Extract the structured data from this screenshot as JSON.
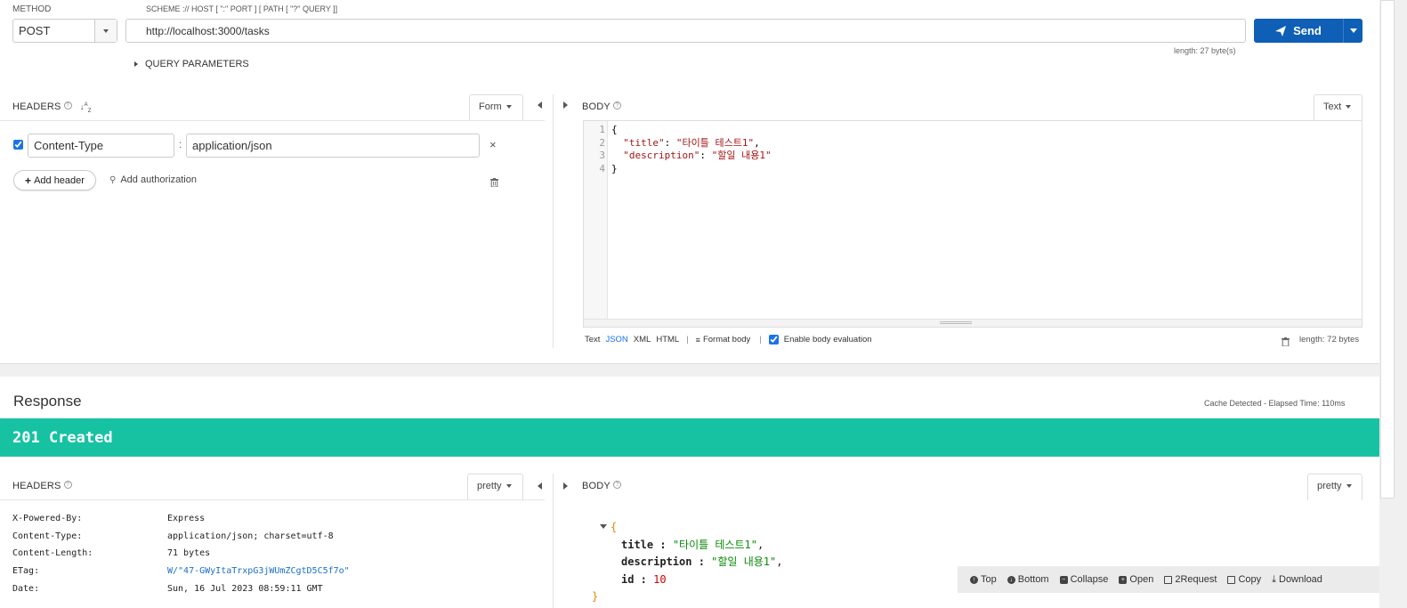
{
  "request": {
    "method_label": "METHOD",
    "method_value": "POST",
    "url_label": "SCHEME :// HOST [ \":\" PORT ] [ PATH [ \"?\" QUERY ]]",
    "url_value": "http://localhost:3000/tasks",
    "send_label": "Send",
    "url_length": "length: 27 byte(s)",
    "query_params_label": "QUERY PARAMETERS"
  },
  "req_headers": {
    "title": "HEADERS",
    "sort_icon": "sort-alpha-icon",
    "view_mode": "Form",
    "rows": [
      {
        "enabled": true,
        "name": "Content-Type",
        "value": "application/json"
      }
    ],
    "add_header_label": "Add header",
    "add_auth_label": "Add authorization"
  },
  "req_body": {
    "title": "BODY",
    "mode": "Text",
    "lines": [
      {
        "num": "1",
        "text": "{"
      },
      {
        "num": "2",
        "key": "\"title\"",
        "sep": ": ",
        "val": "\"타이틀 테스트1\"",
        "end": ","
      },
      {
        "num": "3",
        "key": "\"description\"",
        "sep": ": ",
        "val": "\"할일 내용1\"",
        "end": ""
      },
      {
        "num": "4",
        "text": "}"
      }
    ],
    "formats": [
      "Text",
      "JSON",
      "XML",
      "HTML"
    ],
    "active_format": "JSON",
    "format_body_label": "Format body",
    "enable_eval_label": "Enable body evaluation",
    "length": "length: 72 bytes"
  },
  "response": {
    "title": "Response",
    "cache_info": "Cache Detected - Elapsed Time: 110ms",
    "status": "201 Created",
    "status_color": "#17c2a2",
    "headers_title": "HEADERS",
    "headers_mode": "pretty",
    "headers": [
      {
        "key": "X-Powered-By:",
        "value": "Express"
      },
      {
        "key": "Content-Type:",
        "value": "application/json; charset=utf-8"
      },
      {
        "key": "Content-Length:",
        "value": "71 bytes"
      },
      {
        "key": "ETag:",
        "value": "W/\"47-GWyItaTrxpG3jWUmZCgtD5C5f7o\""
      },
      {
        "key": "Date:",
        "value": "Sun, 16 Jul 2023 08:59:11 GMT"
      }
    ],
    "body_title": "BODY",
    "body_mode": "pretty",
    "body": {
      "open": "{",
      "close": "}",
      "fields": [
        {
          "key": "title",
          "value": "\"타이틀 테스트1\"",
          "end": ","
        },
        {
          "key": "description",
          "value": "\"할일 내용1\"",
          "end": ","
        },
        {
          "key": "id",
          "value": "10",
          "end": ""
        }
      ]
    },
    "toolbar": {
      "top": "Top",
      "bottom": "Bottom",
      "collapse": "Collapse",
      "open": "Open",
      "to_request": "2Request",
      "copy": "Copy",
      "download": "Download"
    }
  },
  "colors": {
    "accent": "#0e5fb5",
    "status": "#17c2a2"
  }
}
